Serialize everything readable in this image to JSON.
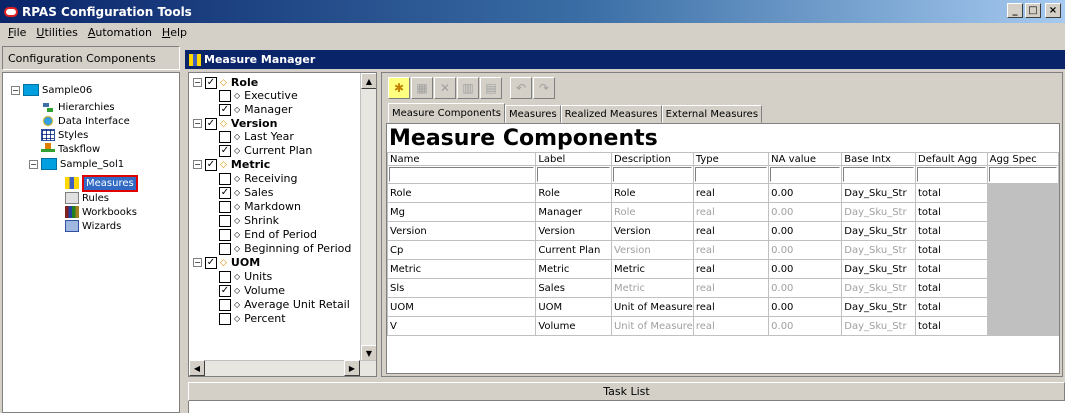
{
  "window": {
    "title": "RPAS Configuration Tools"
  },
  "menu": {
    "items": [
      {
        "pre": "",
        "accel": "F",
        "post": "ile"
      },
      {
        "pre": "",
        "accel": "U",
        "post": "tilities"
      },
      {
        "pre": "",
        "accel": "A",
        "post": "utomation"
      },
      {
        "pre": "",
        "accel": "H",
        "post": "elp"
      }
    ]
  },
  "config_panel": {
    "header": "Configuration Components",
    "tree": {
      "root": "Sample06",
      "root_children": [
        "Hierarchies",
        "Data Interface",
        "Styles",
        "Taskflow"
      ],
      "solution": "Sample_Sol1",
      "solution_children": [
        "Measures",
        "Rules",
        "Workbooks",
        "Wizards"
      ]
    }
  },
  "measure_manager": {
    "title": "Measure Manager",
    "tree": {
      "role": {
        "label": "Role",
        "children": [
          {
            "label": "Executive",
            "checked": false
          },
          {
            "label": "Manager",
            "checked": true
          }
        ]
      },
      "version": {
        "label": "Version",
        "children": [
          {
            "label": "Last Year",
            "checked": false
          },
          {
            "label": "Current Plan",
            "checked": true
          }
        ]
      },
      "metric": {
        "label": "Metric",
        "children": [
          {
            "label": "Receiving",
            "checked": false
          },
          {
            "label": "Sales",
            "checked": true
          },
          {
            "label": "Markdown",
            "checked": false
          },
          {
            "label": "Shrink",
            "checked": false
          },
          {
            "label": "End of Period",
            "checked": false
          },
          {
            "label": "Beginning of Period",
            "checked": false
          }
        ]
      },
      "uom": {
        "label": "UOM",
        "children": [
          {
            "label": "Units",
            "checked": false
          },
          {
            "label": "Volume",
            "checked": true
          },
          {
            "label": "Average Unit Retail",
            "checked": false
          },
          {
            "label": "Percent",
            "checked": false
          }
        ]
      }
    },
    "tabs": [
      "Measure Components",
      "Measures",
      "Realized Measures",
      "External Measures"
    ],
    "grid": {
      "heading": "Measure Components",
      "columns": [
        "Name",
        "Label",
        "Description",
        "Type",
        "NA value",
        "Base Intx",
        "Default Agg",
        "Agg Spec"
      ],
      "rows": [
        [
          "Role",
          "Role",
          "Role",
          "real",
          "0.00",
          "Day_Sku_Str",
          "total",
          ""
        ],
        [
          "Mg",
          "Manager",
          "Role",
          "real",
          "0.00",
          "Day_Sku_Str",
          "total",
          ""
        ],
        [
          "Version",
          "Version",
          "Version",
          "real",
          "0.00",
          "Day_Sku_Str",
          "total",
          ""
        ],
        [
          "Cp",
          "Current Plan",
          "Version",
          "real",
          "0.00",
          "Day_Sku_Str",
          "total",
          ""
        ],
        [
          "Metric",
          "Metric",
          "Metric",
          "real",
          "0.00",
          "Day_Sku_Str",
          "total",
          ""
        ],
        [
          "Sls",
          "Sales",
          "Metric",
          "real",
          "0.00",
          "Day_Sku_Str",
          "total",
          ""
        ],
        [
          "UOM",
          "UOM",
          "Unit of Measure",
          "real",
          "0.00",
          "Day_Sku_Str",
          "total",
          ""
        ],
        [
          "V",
          "Volume",
          "Unit of Measure",
          "real",
          "0.00",
          "Day_Sku_Str",
          "total",
          ""
        ]
      ]
    }
  },
  "task_list": {
    "label": "Task List"
  }
}
